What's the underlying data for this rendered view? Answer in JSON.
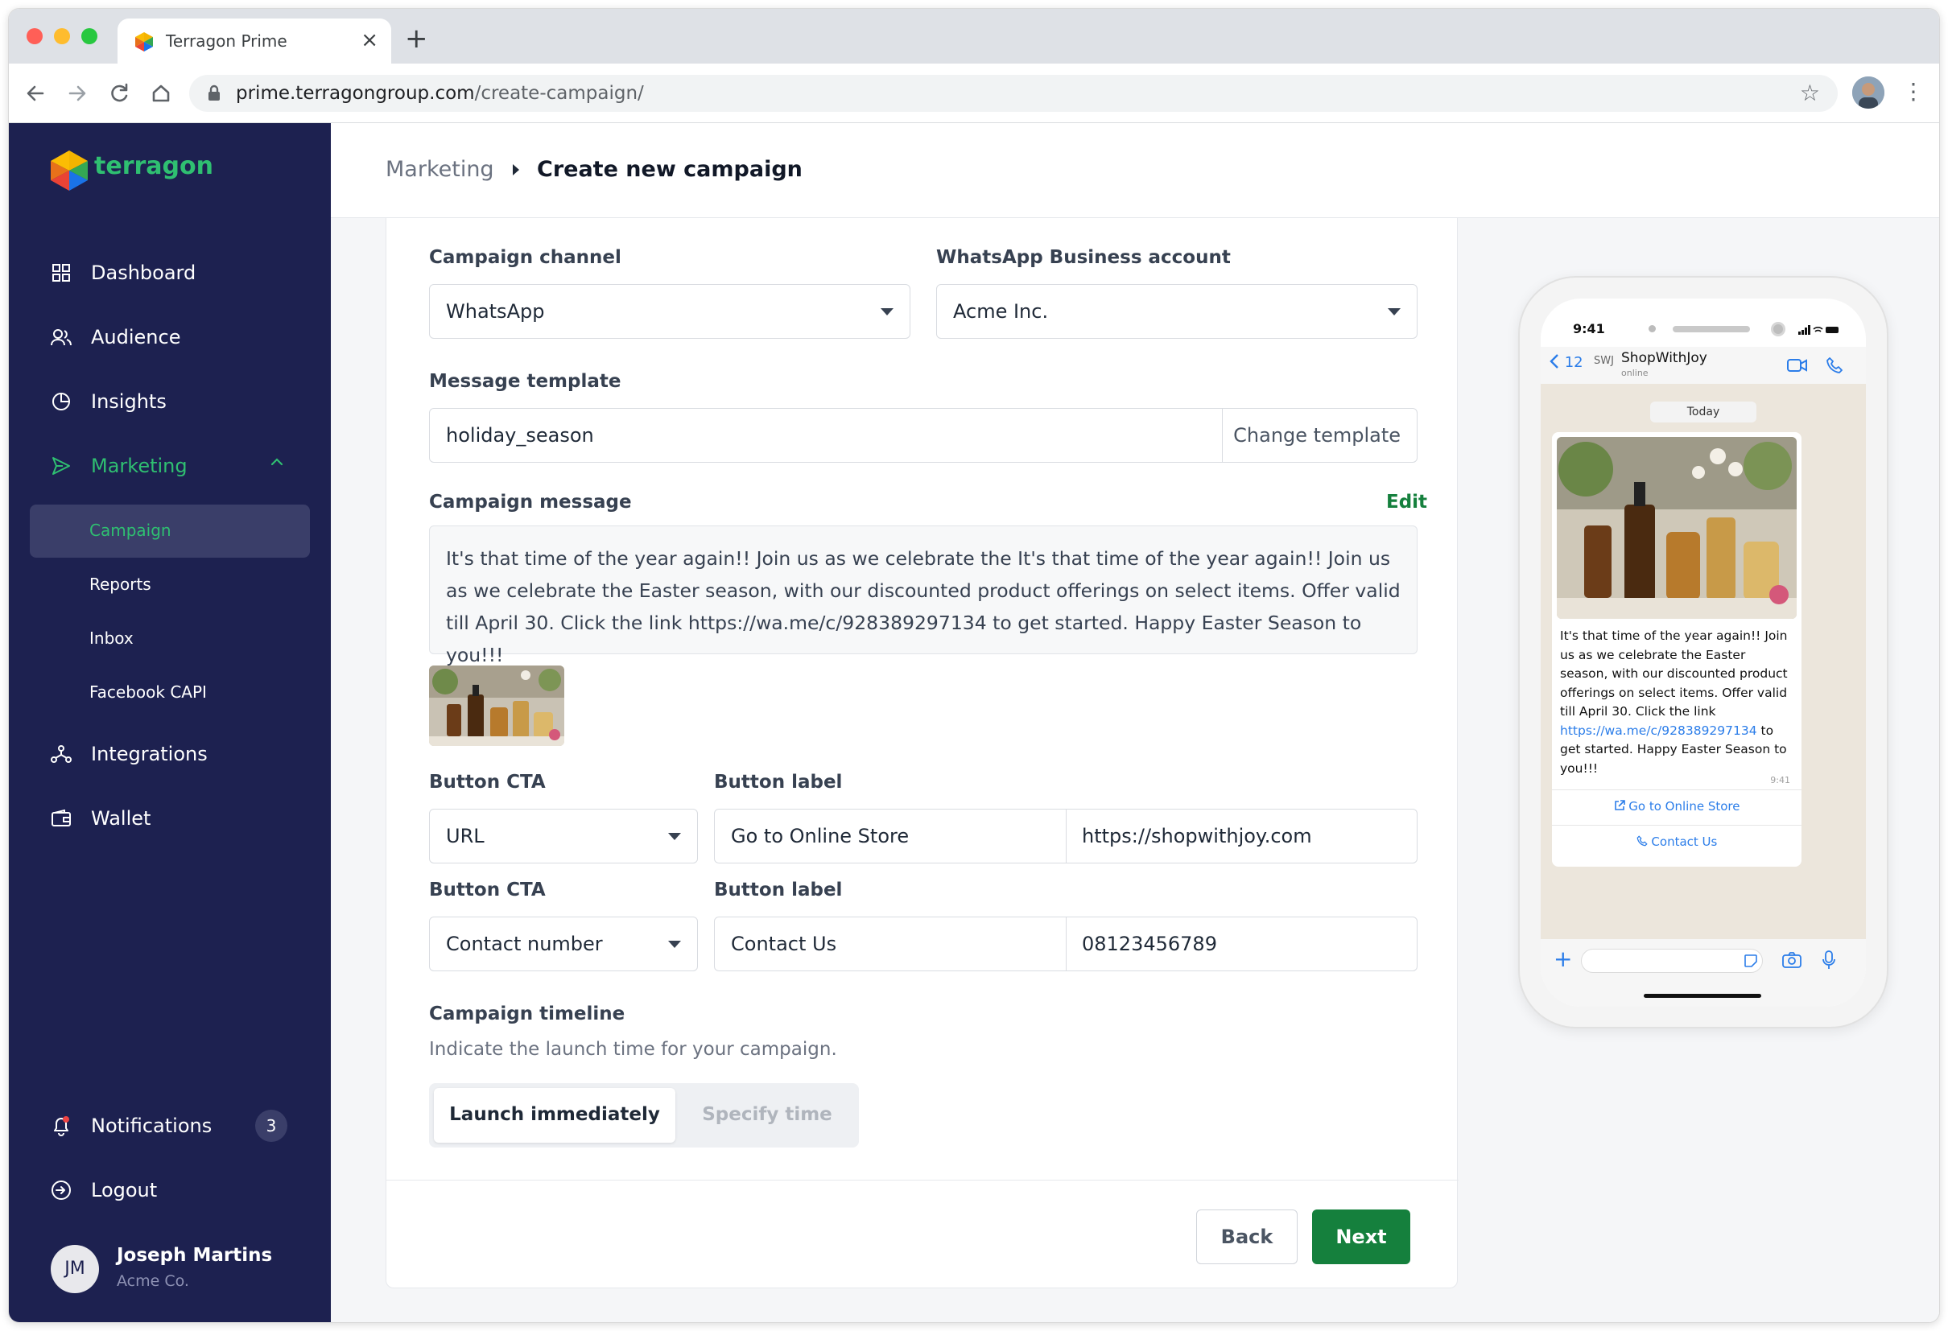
{
  "browser": {
    "tab_title": "Terragon Prime",
    "url_host": "prime.terragongroup.com",
    "url_path": "/create-campaign/"
  },
  "sidebar": {
    "brand": "terragon",
    "items": [
      {
        "label": "Dashboard",
        "icon": "grid-icon"
      },
      {
        "label": "Audience",
        "icon": "users-icon"
      },
      {
        "label": "Insights",
        "icon": "pie-chart-icon"
      },
      {
        "label": "Marketing",
        "icon": "send-icon",
        "active": true
      },
      {
        "label": "Integrations",
        "icon": "nodes-icon"
      },
      {
        "label": "Wallet",
        "icon": "wallet-icon"
      }
    ],
    "sub_items": [
      {
        "label": "Campaign",
        "active": true
      },
      {
        "label": "Reports"
      },
      {
        "label": "Inbox"
      },
      {
        "label": "Facebook CAPI"
      }
    ],
    "notifications": {
      "label": "Notifications",
      "count": "3"
    },
    "logout": "Logout",
    "user": {
      "initials": "JM",
      "name": "Joseph Martins",
      "org": "Acme Co."
    }
  },
  "header": {
    "breadcrumb_parent": "Marketing",
    "breadcrumb_current": "Create new campaign"
  },
  "form": {
    "channel": {
      "label": "Campaign channel",
      "value": "WhatsApp"
    },
    "account": {
      "label": "WhatsApp Business account",
      "value": "Acme Inc."
    },
    "template": {
      "label": "Message template",
      "value": "holiday_season",
      "change_label": "Change template"
    },
    "message": {
      "label": "Campaign message",
      "edit_label": "Edit",
      "text": "It's that time of the year again!! Join us as we celebrate the It's that time of the year again!! Join us as we celebrate the Easter season, with our discounted product offerings on select items. Offer valid till April 30. Click the link https://wa.me/c/928389297134 to get started. Happy Easter Season to you!!!"
    },
    "buttons": [
      {
        "cta_label": "Button CTA",
        "cta_value": "URL",
        "label_label": "Button label",
        "label_value": "Go to Online Store",
        "target": "https://shopwithjoy.com"
      },
      {
        "cta_label": "Button CTA",
        "cta_value": "Contact number",
        "label_label": "Button label",
        "label_value": "Contact Us",
        "target": "08123456789"
      }
    ],
    "timeline": {
      "label": "Campaign timeline",
      "hint": "Indicate the launch time for your campaign.",
      "option_selected": "Launch immediately",
      "option_other": "Specify time"
    },
    "back_label": "Back",
    "next_label": "Next"
  },
  "preview": {
    "time": "9:41",
    "back_count": "12",
    "contact_logo": "SWJ",
    "contact_name": "ShopWithJoy",
    "contact_status": "online",
    "date_chip": "Today",
    "bubble_text_before": "It's that time of the year again!! Join us as we celebrate the Easter season, with our discounted product offerings on select items. Offer valid till April 30. Click the link ",
    "bubble_link": "https://wa.me/c/928389297134",
    "bubble_text_after": " to get started. Happy Easter Season to you!!!",
    "bubble_time": "9:41",
    "cta_1": "Go to Online Store",
    "cta_2": "Contact Us"
  },
  "colors": {
    "sidebar_bg": "#1d2150",
    "accent_green": "#15803d",
    "brand_green": "#2fbf71",
    "link_blue": "#2b7de9"
  }
}
